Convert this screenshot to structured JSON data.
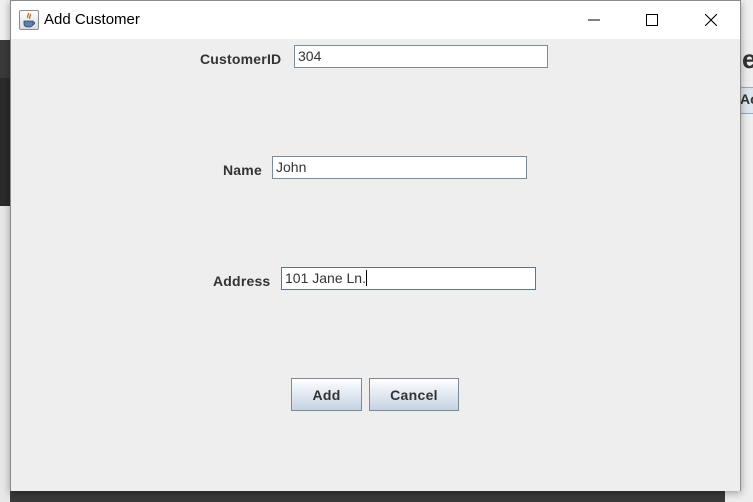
{
  "window": {
    "title": "Add Customer"
  },
  "form": {
    "customer_id": {
      "label": "CustomerID",
      "value": "304"
    },
    "name": {
      "label": "Name",
      "value": "John"
    },
    "address": {
      "label": "Address",
      "value": "101 Jane Ln."
    }
  },
  "buttons": {
    "add_label": "Add",
    "cancel_label": "Cancel"
  },
  "background_app": {
    "partial_heading": "e",
    "partial_tab": "Ac"
  },
  "icons": {
    "app": "java-cup-icon",
    "minimize": "minimize-icon",
    "maximize": "maximize-icon",
    "close": "close-icon"
  },
  "colors": {
    "dialog_bg": "#eeeeee",
    "titlebar_bg": "#ffffff",
    "button_gradient_top": "#ffffff",
    "button_gradient_bottom": "#c6d3e2",
    "field_border": "#7a8a99"
  }
}
